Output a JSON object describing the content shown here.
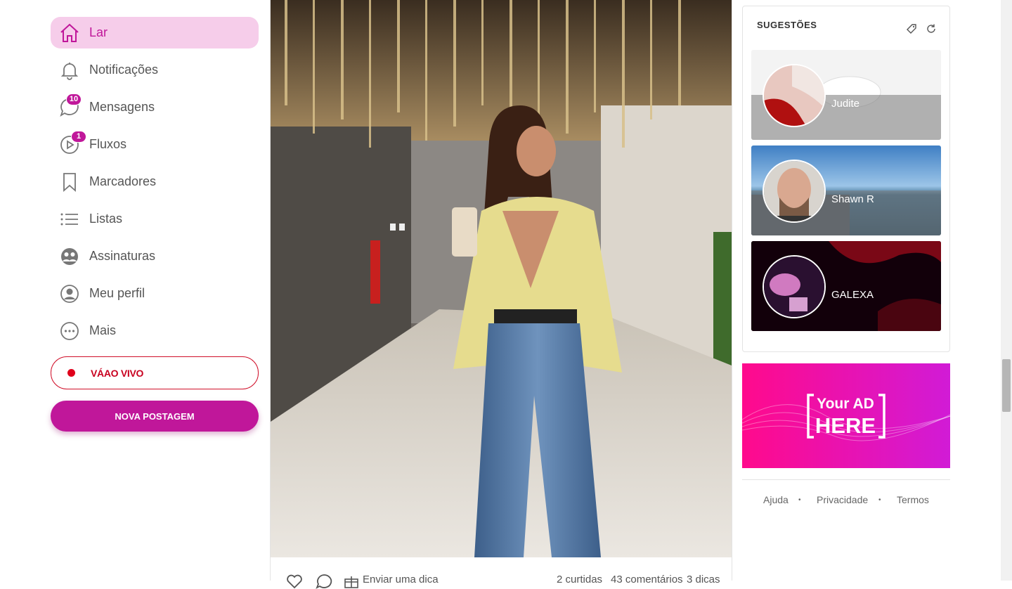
{
  "sidebar": {
    "items": [
      {
        "label": "Lar",
        "icon": "home-icon"
      },
      {
        "label": "Notificações",
        "icon": "bell-icon"
      },
      {
        "label": "Mensagens",
        "icon": "chat-icon",
        "badge": "10"
      },
      {
        "label": "Fluxos",
        "icon": "play-icon",
        "badge": "1"
      },
      {
        "label": "Marcadores",
        "icon": "bookmark-icon"
      },
      {
        "label": "Listas",
        "icon": "list-icon"
      },
      {
        "label": "Assinaturas",
        "icon": "subscriptions-icon"
      },
      {
        "label": "Meu perfil",
        "icon": "user-icon"
      },
      {
        "label": "Mais",
        "icon": "more-icon"
      }
    ],
    "live_label": "VÁAO VIVO",
    "new_post_label": "NOVA POSTAGEM"
  },
  "post": {
    "actions": {
      "tip_label": "Enviar uma dica",
      "likes": "2 curtidas",
      "comments": "43 comentários",
      "tips": "3 dicas"
    }
  },
  "suggestions": {
    "title": "SUGESTÕES",
    "cards": [
      {
        "name": "Judite"
      },
      {
        "name": "Shawn R"
      },
      {
        "name": "GALEXA"
      }
    ]
  },
  "ad": {
    "line1": "Your AD",
    "line2": "HERE"
  },
  "footer": {
    "links": [
      "Ajuda",
      "Privacidade",
      "Termos"
    ],
    "separator": "•"
  },
  "colors": {
    "accent": "#c0179a",
    "active_bg": "#f6cdea",
    "live": "#d0102a",
    "ad_pink": "#ff0a8c"
  }
}
